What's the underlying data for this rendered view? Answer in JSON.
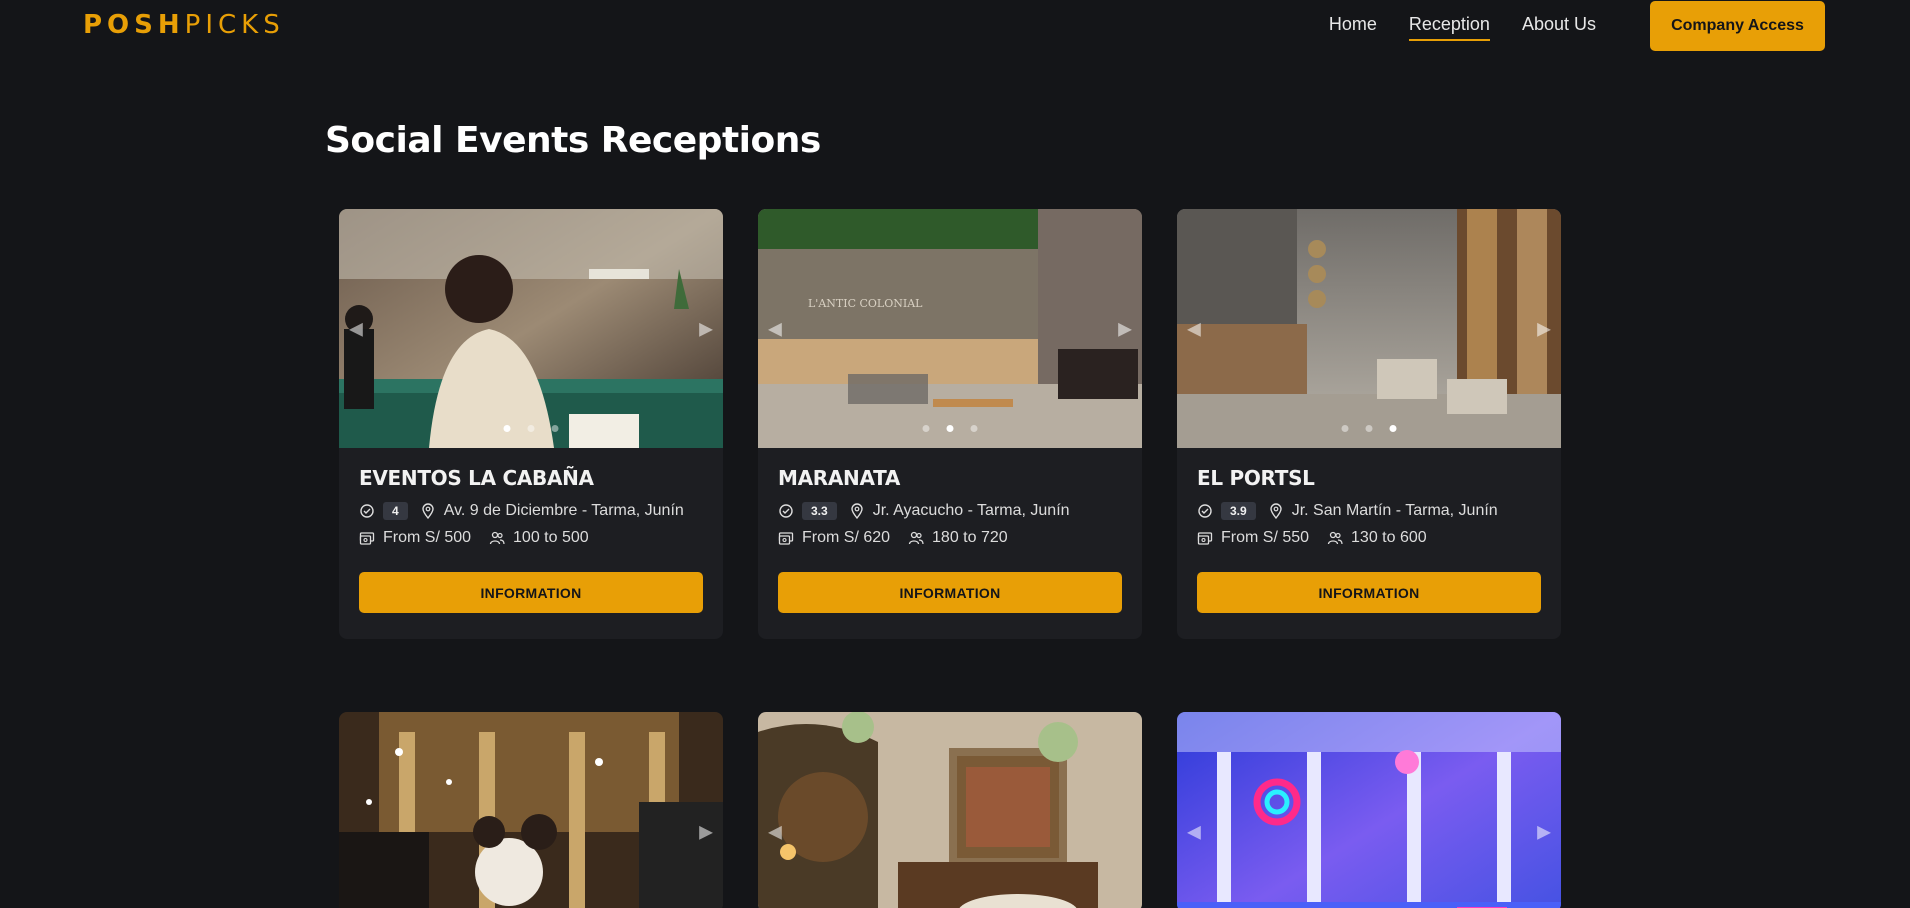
{
  "brand": {
    "logo_bold": "POSH",
    "logo_light": "PICKS",
    "accent": "#e89f06"
  },
  "nav": {
    "items": [
      {
        "label": "Home",
        "active": false
      },
      {
        "label": "Reception",
        "active": true
      },
      {
        "label": "About Us",
        "active": false
      }
    ],
    "cta": "Company Access"
  },
  "page": {
    "title": "Social Events Receptions"
  },
  "cards": [
    {
      "name": "EVENTOS LA CABAÑA",
      "rating": "4",
      "address": "Av. 9 de Diciembre - Tarma, Junín",
      "price": "From S/ 500",
      "capacity": "100 to 500",
      "button": "INFORMATION",
      "active_dot": 0
    },
    {
      "name": "MARANATA",
      "rating": "3.3",
      "address": "Jr. Ayacucho - Tarma, Junín",
      "price": "From S/ 620",
      "capacity": "180 to 720",
      "button": "INFORMATION",
      "active_dot": 1
    },
    {
      "name": "EL PORTSL",
      "rating": "3.9",
      "address": "Jr. San Martín - Tarma, Junín",
      "price": "From S/ 550",
      "capacity": "130 to 600",
      "button": "INFORMATION",
      "active_dot": 2
    }
  ],
  "icons": {
    "rating": "badge-check-icon",
    "location": "map-pin-icon",
    "price": "money-icon",
    "capacity": "users-icon",
    "prev": "chevron-left-icon",
    "next": "chevron-right-icon"
  }
}
